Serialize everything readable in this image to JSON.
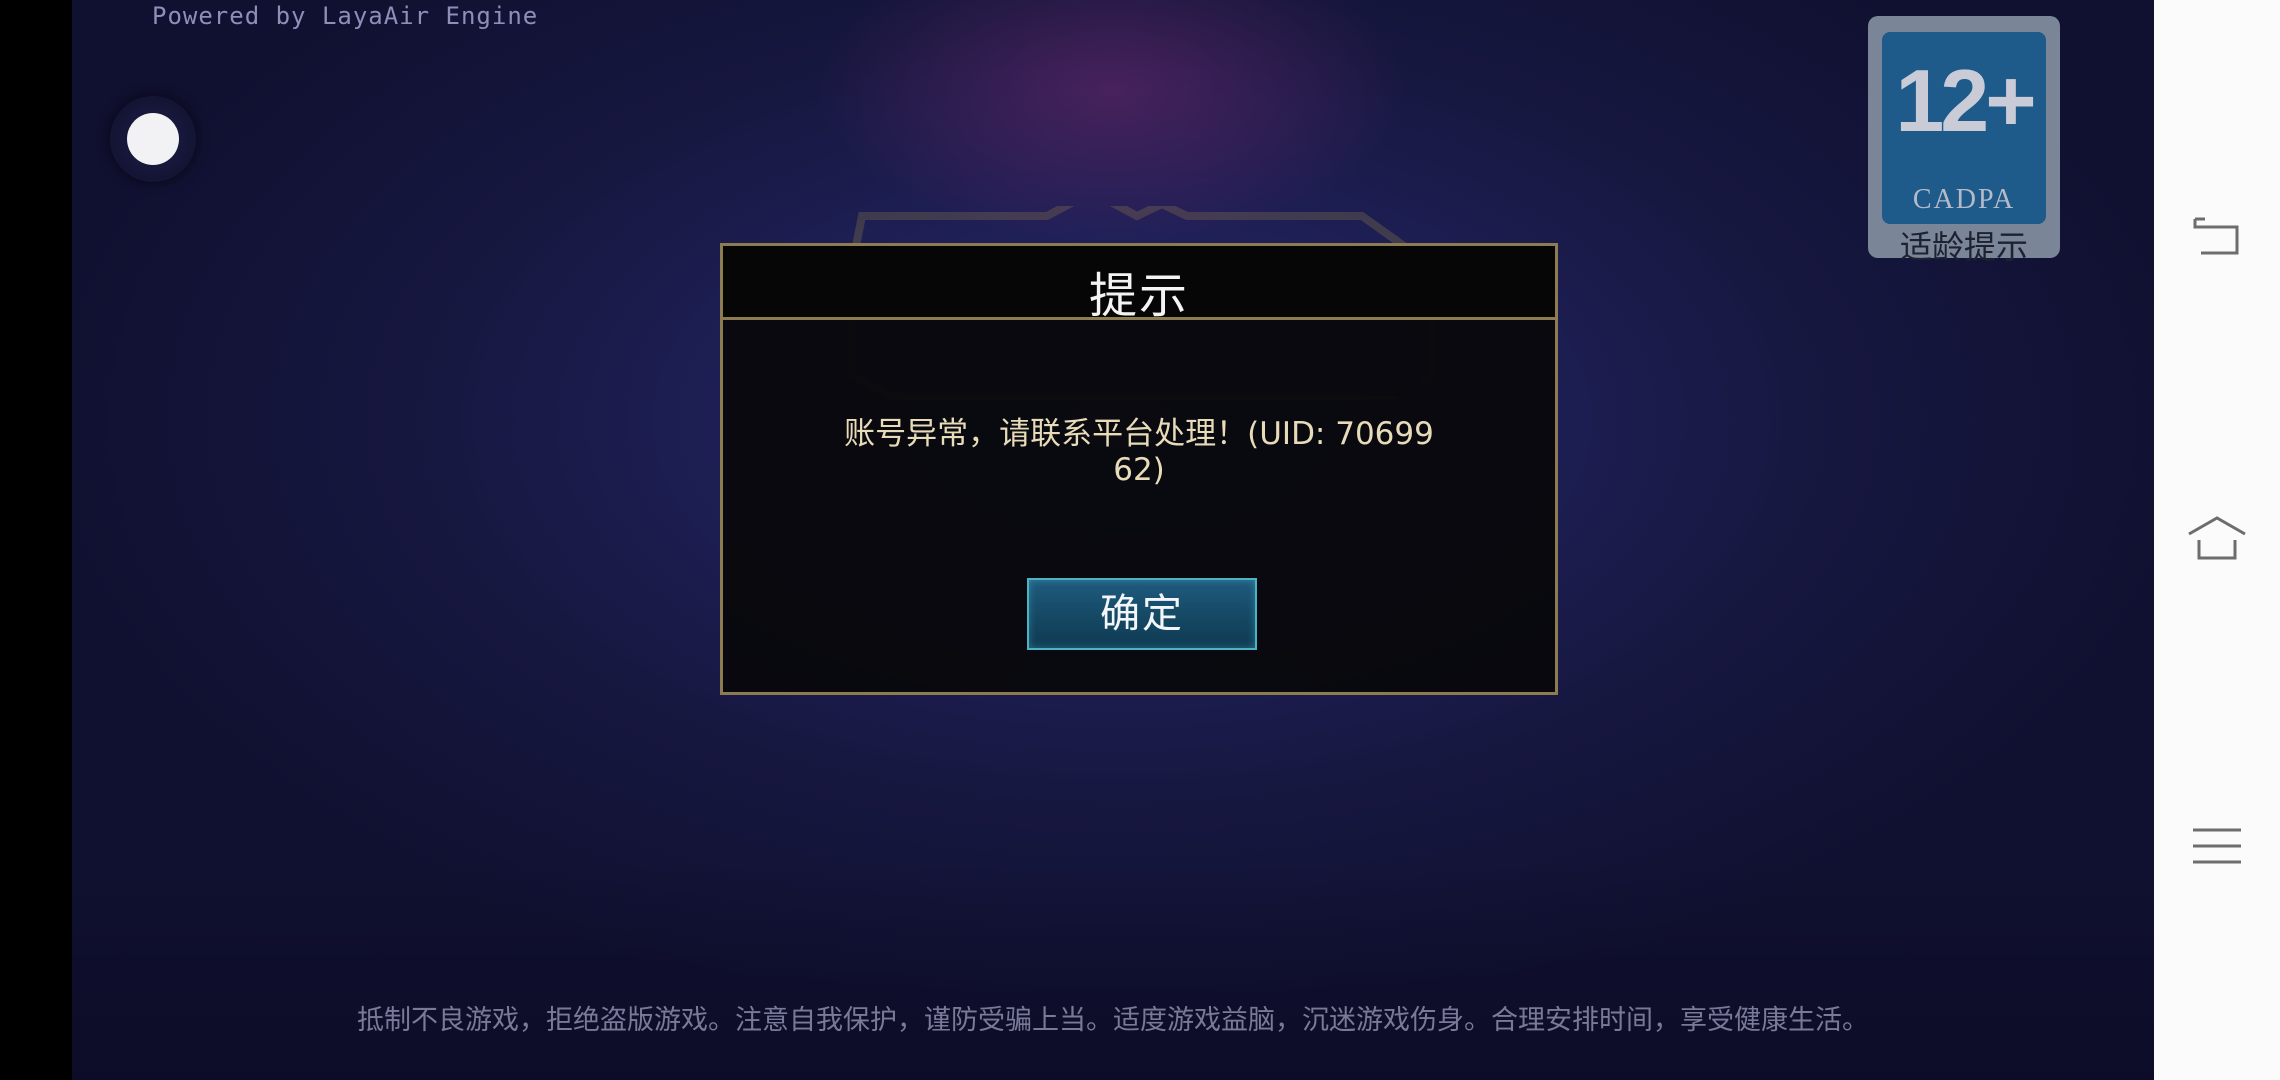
{
  "game": {
    "powered_by": "Powered by LayaAir Engine",
    "footer_notice": "抵制不良游戏，拒绝盗版游戏。注意自我保护，谨防受骗上当。适度游戏益脑，沉迷游戏伤身。合理安排时间，享受健康生活。"
  },
  "age_rating": {
    "age": "12+",
    "org": "CADPA",
    "label": "适龄提示"
  },
  "dialog": {
    "title": "提示",
    "message": "账号异常，请联系平台处理！(UID: 7069962)",
    "confirm_label": "确定"
  },
  "system_nav": {
    "items": [
      "back-icon",
      "home-icon",
      "menu-icon"
    ]
  },
  "colors": {
    "dialog_border": "#8d7c52",
    "button_border": "#48b4c4",
    "message_text": "#e8dcb8",
    "badge_blue": "#1e5a8a"
  }
}
